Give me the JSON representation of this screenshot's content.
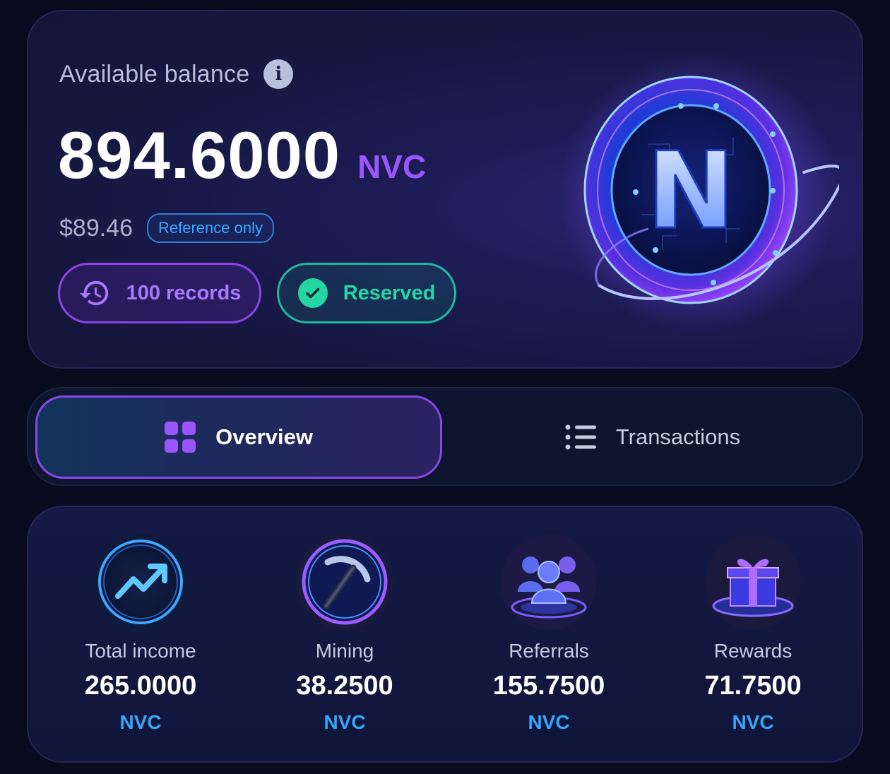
{
  "balance": {
    "label": "Available balance",
    "amount": "894.6000",
    "unit": "NVC",
    "usd_value": "$89.46",
    "reference_badge": "Reference only",
    "records_label": "100 records",
    "reserved_label": "Reserved",
    "coin_letter": "N"
  },
  "tabs": {
    "overview": "Overview",
    "transactions": "Transactions"
  },
  "stats": [
    {
      "label": "Total income",
      "value": "265.0000",
      "unit": "NVC",
      "icon": "trend-up-icon"
    },
    {
      "label": "Mining",
      "value": "38.2500",
      "unit": "NVC",
      "icon": "pickaxe-icon"
    },
    {
      "label": "Referrals",
      "value": "155.7500",
      "unit": "NVC",
      "icon": "users-group-icon"
    },
    {
      "label": "Rewards",
      "value": "71.7500",
      "unit": "NVC",
      "icon": "gift-icon"
    }
  ],
  "colors": {
    "background": "#070b1d",
    "accent_purple": "#9b55ff",
    "accent_teal": "#26d6a8",
    "accent_blue": "#36a6f8"
  }
}
